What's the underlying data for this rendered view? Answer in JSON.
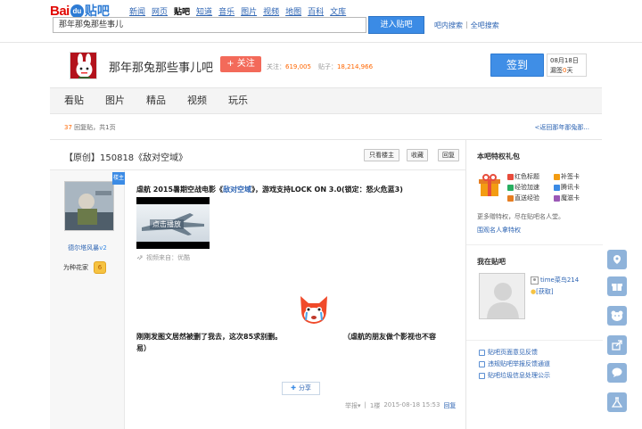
{
  "header": {
    "logo_bai": "Bai",
    "logo_du": "du",
    "logo_tieba": "贴吧",
    "nav": [
      "新闻",
      "网页",
      "贴吧",
      "知道",
      "音乐",
      "图片",
      "视频",
      "地图",
      "百科",
      "文库"
    ],
    "search_value": "那年那兔那些事儿",
    "search_button": "进入贴吧",
    "link_search_in_bar": "吧内搜索",
    "link_sep": "|",
    "link_search_all": "全吧搜索"
  },
  "forum": {
    "name": "那年那兔那些事儿吧",
    "follow": "+ 关注",
    "followers_label": "关注：",
    "followers": "619,005",
    "posts_label": "贴子：",
    "posts": "18,214,966",
    "signin": "签到",
    "sign_date": "08月18日",
    "sign_streak_label": "漏签",
    "sign_streak_value": "0",
    "sign_streak_unit": "天"
  },
  "tabs": [
    "看贴",
    "图片",
    "精品",
    "视频",
    "玩乐"
  ],
  "inforow": {
    "reply_count": "37",
    "reply_text": "回复贴，共1页",
    "back_link": "<返回那年那兔那..."
  },
  "thread": {
    "title": "【原创】150818《敌对空域》",
    "btn_author_only": "只看楼主",
    "btn_favorite": "收藏",
    "btn_reply": "回复"
  },
  "post": {
    "badge": "楼主",
    "author_name": "德尔塔风暴",
    "author_level_tag": "v2",
    "author_rank": "为种花家",
    "author_level": "6",
    "headline_pre": "虐航 2015暑期空战电影《",
    "headline_link": "敌对空域",
    "headline_post": "》，游戏支持LOCK ON 3.0(锁定：怒火危蓝3)",
    "video_play": "点击播放",
    "video_source": "视频来自：优酷",
    "body_line1_left": "刚刚发图文居然被删了我去，这次85求别删。",
    "body_line1_right": "（虐航的朋友做个影视也不容",
    "body_line2": "易）",
    "share": "分享",
    "meta_report": "举报",
    "meta_report_arrow": "▾",
    "meta_sep": "|",
    "meta_floor": "1楼",
    "meta_time": "2015-08-18 15:53",
    "meta_reply": "回复"
  },
  "sidebar": {
    "perk_title": "本吧特权礼包",
    "perks": [
      "红色标题",
      "补签卡",
      "经验加速",
      "腾讯卡",
      "直送经验",
      "魔滋卡"
    ],
    "perk_colors": [
      "#e74c3c",
      "#f39c12",
      "#27ae60",
      "#3b8be5",
      "#e67e22",
      "#9b59b6"
    ],
    "perk_desc": "更多赠特权，尽在贴吧名人堂。",
    "perk_link": "围观名人拿特权",
    "my_title": "我在贴吧",
    "my_name": "time菜鸟214",
    "my_get": "[获取]",
    "links": [
      "贴吧页面意见反馈",
      "违规贴吧举报反馈通道",
      "贴吧垃圾信息处理公示"
    ]
  },
  "colors": {
    "accent_blue": "#3b8be5",
    "follow_red": "#f36a5a",
    "logo_red": "#e10601",
    "link_blue": "#2d64b3"
  }
}
